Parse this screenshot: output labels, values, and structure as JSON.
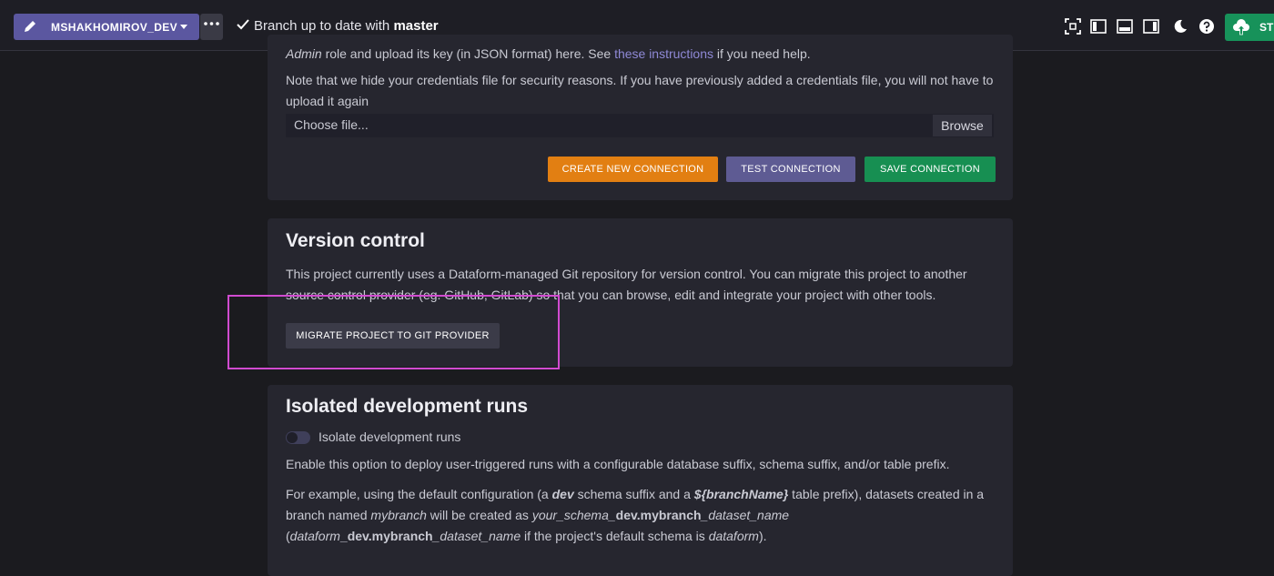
{
  "topbar": {
    "branch_name": "MSHAKHOMIROV_DEV",
    "status_prefix": "Branch up to date with ",
    "status_branch": "master",
    "start_label": "ST"
  },
  "credentials": {
    "line1_prefix": "Admin",
    "line1_middle": " role and upload its key (in JSON format) here. See ",
    "line1_link": "these instructions",
    "line1_suffix": " if you need help.",
    "note": "Note that we hide your credentials file for security reasons. If you have previously added a credentials file, you will not have to upload it again",
    "file_placeholder": "Choose file...",
    "browse_label": "Browse",
    "create_label": "CREATE NEW CONNECTION",
    "test_label": "TEST CONNECTION",
    "save_label": "SAVE CONNECTION"
  },
  "version_control": {
    "title": "Version control",
    "description": "This project currently uses a Dataform-managed Git repository for version control. You can migrate this project to another source control provider (eg. GitHub, GitLab) so that you can browse, edit and integrate your project with other tools.",
    "migrate_label": "MIGRATE PROJECT TO GIT PROVIDER"
  },
  "isolated_runs": {
    "title": "Isolated development runs",
    "toggle_label": "Isolate development runs",
    "toggle_on": false,
    "description": "Enable this option to deploy user-triggered runs with a configurable database suffix, schema suffix, and/or table prefix.",
    "ex_1": "For example, using the default configuration (a ",
    "ex_dev": "dev",
    "ex_2": " schema suffix and a ",
    "ex_prefix": "${branchName}",
    "ex_3": " table prefix), datasets created in a branch named ",
    "ex_mybranch": "mybranch",
    "ex_4": " will be created as ",
    "ex_schema": "your_schema_",
    "ex_devbranch": "dev.mybranch",
    "ex_dataset": "_dataset_name",
    "ex_5": " (",
    "ex_dataform": "dataform",
    "ex_devbranch2": "_dev.mybranch",
    "ex_dataset2": "_dataset_name",
    "ex_6": " if the project's default schema is ",
    "ex_dataform2": "dataform",
    "ex_7": ")."
  },
  "colors": {
    "branch_button": "#5b57a0",
    "create_button": "#e27f12",
    "test_button": "#5e5b93",
    "save_button": "#178f52",
    "highlight": "#d14bd0"
  }
}
